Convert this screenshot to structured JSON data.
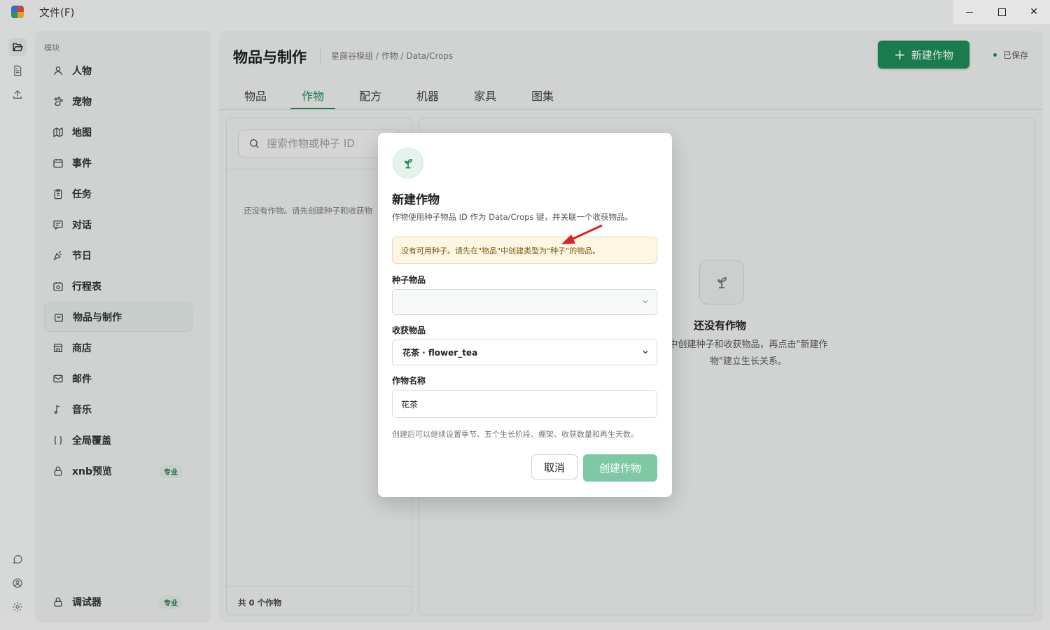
{
  "app": {
    "menu_file": "文件(F)"
  },
  "window_controls": {
    "close": "✕"
  },
  "sidebar": {
    "heading": "模块",
    "items": [
      {
        "label": "人物",
        "icon": "person-icon"
      },
      {
        "label": "宠物",
        "icon": "paw-icon"
      },
      {
        "label": "地图",
        "icon": "map-icon"
      },
      {
        "label": "事件",
        "icon": "calendar-icon"
      },
      {
        "label": "任务",
        "icon": "clipboard-icon"
      },
      {
        "label": "对话",
        "icon": "chat-icon"
      },
      {
        "label": "节日",
        "icon": "party-icon"
      },
      {
        "label": "行程表",
        "icon": "schedule-icon"
      },
      {
        "label": "物品与制作",
        "icon": "bag-icon",
        "active": true
      },
      {
        "label": "商店",
        "icon": "store-icon"
      },
      {
        "label": "邮件",
        "icon": "mail-icon"
      },
      {
        "label": "音乐",
        "icon": "music-note-icon"
      },
      {
        "label": "全局覆盖",
        "icon": "braces-icon"
      },
      {
        "label": "xnb预览",
        "icon": "lock-icon",
        "badge": "专业"
      }
    ],
    "bottom_item": {
      "label": "调试器",
      "icon": "lock-icon",
      "badge": "专业"
    }
  },
  "header": {
    "title": "物品与制作",
    "breadcrumb": "星露谷模组 / 作物 / Data/Crops",
    "new_button": "新建作物",
    "saved_status": "已保存"
  },
  "tabs": [
    "物品",
    "作物",
    "配方",
    "机器",
    "家具",
    "图集"
  ],
  "active_tab": "作物",
  "list_pane": {
    "search_placeholder": "搜索作物或种子 ID",
    "empty_text": "还没有作物。请先创建种子和收获物",
    "count_text": "共 0 个作物"
  },
  "detail_pane": {
    "empty_title": "还没有作物",
    "empty_desc": "中创建种子和收获物品，再点击\"新建作物\"建立生长关系。"
  },
  "dialog": {
    "title": "新建作物",
    "description": "作物使用种子物品 ID 作为 Data/Crops 键，并关联一个收获物品。",
    "warning": "没有可用种子。请先在\"物品\"中创建类型为\"种子\"的物品。",
    "seed_label": "种子物品",
    "seed_value": "",
    "harvest_label": "收获物品",
    "harvest_value": "花茶 · flower_tea",
    "name_label": "作物名称",
    "name_value": "花茶",
    "note": "创建后可以继续设置季节、五个生长阶段、棚架、收获数量和再生天数。",
    "cancel": "取消",
    "create": "创建作物"
  },
  "colors": {
    "accent": "#1e8a58",
    "accent_disabled": "#7fc8a6",
    "warning_bg": "#fdf6e3",
    "annotation_arrow": "#e02020"
  }
}
